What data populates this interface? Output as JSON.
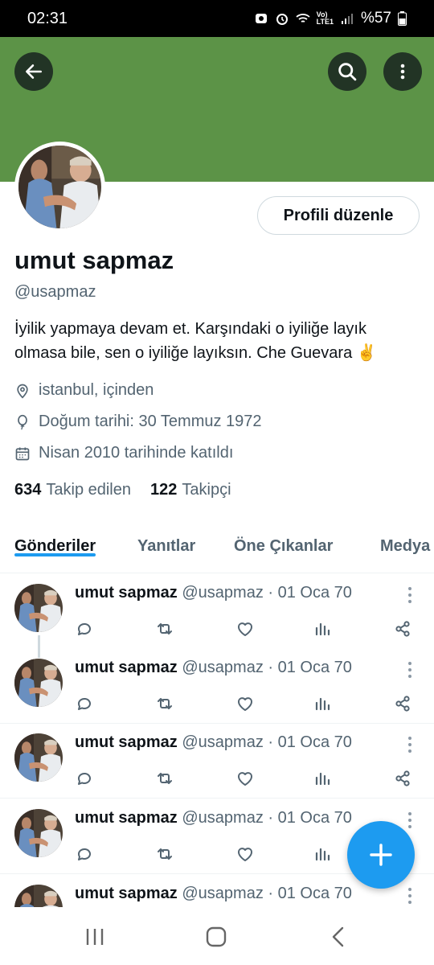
{
  "status_bar": {
    "time": "02:31",
    "battery": "%57",
    "network": "Vo)\nLTE1"
  },
  "theme": {
    "banner_color": "#5c9347",
    "accent": "#1d9bf0"
  },
  "header": {
    "back_icon": "arrow-left-icon",
    "search_icon": "search-icon",
    "more_icon": "more-vertical-icon"
  },
  "profile": {
    "edit_label": "Profili düzenle",
    "name": "umut sapmaz",
    "handle": "@usapmaz",
    "bio_line1": "İyilik yapmaya devam et. Karşındaki o iyiliğe layık",
    "bio_line2": "olmasa bile, sen o iyiliğe layıksın. Che Guevara ✌️",
    "location": "istanbul, içinden",
    "birthday": "Doğum tarihi: 30 Temmuz 1972",
    "joined": "Nisan 2010 tarihinde katıldı",
    "following_count": "634",
    "following_label": "Takip edilen",
    "followers_count": "122",
    "followers_label": "Takipçi"
  },
  "tabs": [
    {
      "label": "Gönderiler"
    },
    {
      "label": "Yanıtlar"
    },
    {
      "label": "Öne Çıkanlar"
    },
    {
      "label": "Medya"
    }
  ],
  "posts": [
    {
      "name": "umut sapmaz",
      "meta": "@usapmaz · 01 Oca 70"
    },
    {
      "name": "umut sapmaz",
      "meta": "@usapmaz · 01 Oca 70"
    },
    {
      "name": "umut sapmaz",
      "meta": "@usapmaz · 01 Oca 70"
    },
    {
      "name": "umut sapmaz",
      "meta": "@usapmaz · 01 Oca 70"
    },
    {
      "name": "umut sapmaz",
      "meta": "@usapmaz · 01 Oca 70"
    }
  ],
  "fab": {
    "icon": "plus-icon"
  },
  "nav": {
    "recents_icon": "recents-icon",
    "home_icon": "home-icon",
    "back_icon": "nav-back-icon"
  }
}
